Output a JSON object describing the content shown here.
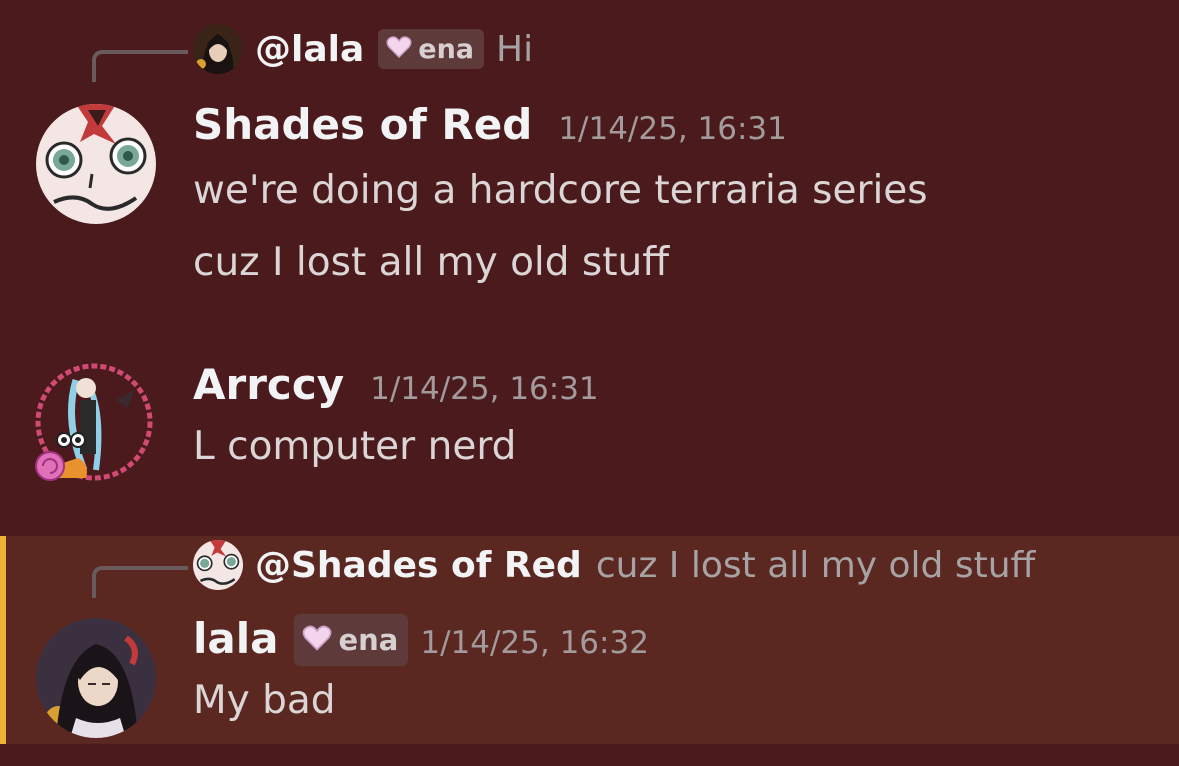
{
  "messages": [
    {
      "reply": {
        "author": "@lala",
        "tag": "ena",
        "text": "Hi"
      },
      "author": "Shades of Red",
      "timestamp": "1/14/25, 16:31",
      "lines": [
        "we're doing a hardcore terraria series",
        "cuz I lost all my old stuff"
      ]
    },
    {
      "author": "Arrccy",
      "timestamp": "1/14/25, 16:31",
      "lines": [
        "L computer nerd"
      ]
    },
    {
      "reply": {
        "author": "@Shades of Red",
        "text": "cuz I lost all my old stuff"
      },
      "author": "lala",
      "tag": "ena",
      "timestamp": "1/14/25, 16:32",
      "lines": [
        "My bad"
      ],
      "highlighted": true
    }
  ],
  "colors": {
    "background": "#4a1a1c",
    "highlight_background": "#5a2820",
    "highlight_border": "#f0b232"
  },
  "icons": {
    "tag_icon": "heart-icon"
  }
}
